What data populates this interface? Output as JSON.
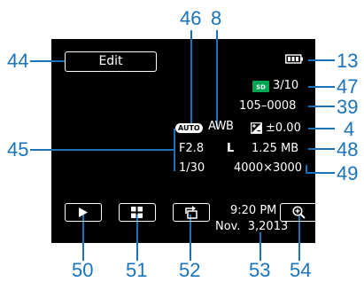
{
  "callouts": {
    "c44": "44",
    "c46": "46",
    "c8": "8",
    "c13": "13",
    "c47": "47",
    "c39": "39",
    "c4": "4",
    "c45": "45",
    "c48": "48",
    "c49": "49",
    "c50": "50",
    "c51": "51",
    "c52": "52",
    "c53": "53",
    "c54": "54"
  },
  "screen": {
    "edit_label": "Edit",
    "card_count": "3/10",
    "file_number": "105–0008",
    "exposure": "±0.00",
    "auto_badge": "AUTO",
    "awb": "AWB",
    "aperture": "F2.8",
    "size_code": "L",
    "file_size": "1.25 MB",
    "shutter": "1/30",
    "resolution": "4000×3000",
    "time": "9:20 PM",
    "date": "Nov.  3,2013"
  },
  "colors": {
    "accent": "#1a73b8",
    "screen_bg": "#000000",
    "sd_green": "#00a651"
  },
  "icons": [
    "battery-icon",
    "sd-card-icon",
    "exposure-icon",
    "play-icon",
    "index-icon",
    "rotate-icon",
    "zoom-icon"
  ]
}
